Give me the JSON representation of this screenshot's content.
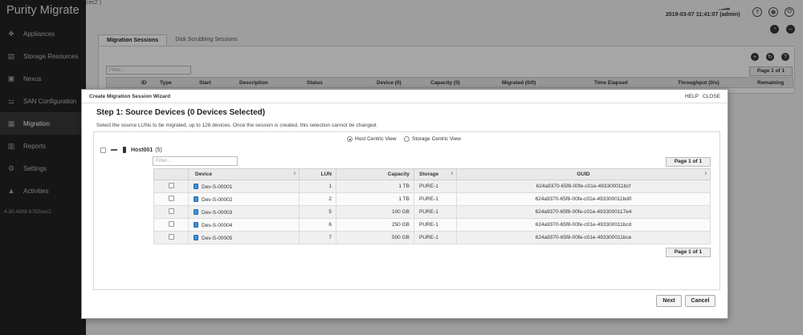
{
  "app": {
    "logo": "Purity Migrate",
    "version": "4.30.4308.6782cec2",
    "breadcrumb": "cec2 )"
  },
  "sidebar": {
    "items": [
      {
        "label": "Appliances",
        "icon": "layers-icon",
        "active": false
      },
      {
        "label": "Storage Resources",
        "icon": "storage-icon",
        "active": false
      },
      {
        "label": "Nexus",
        "icon": "nexus-icon",
        "active": false
      },
      {
        "label": "SAN Configuration",
        "icon": "san-icon",
        "active": false
      },
      {
        "label": "Migration",
        "icon": "migration-icon",
        "active": true
      },
      {
        "label": "Reports",
        "icon": "reports-icon",
        "active": false
      },
      {
        "label": "Settings",
        "icon": "gear-icon",
        "active": false
      },
      {
        "label": "Activities",
        "icon": "bell-icon",
        "active": false
      }
    ]
  },
  "header": {
    "datetime": "2019-03-07 11:41:07 (admin)",
    "icons": [
      "help-icon",
      "settings-icon",
      "power-icon"
    ]
  },
  "background": {
    "tabs": [
      "Migration Sessions",
      "Disk Scrubbing Sessions"
    ],
    "filter_placeholder": "Filter...",
    "pager": "Page 1 of 1",
    "columns": [
      "ID",
      "Type",
      "Start",
      "Description",
      "Status",
      "Device (0)",
      "Capacity (0)",
      "Migrated (0/0)",
      "Time Elapsed",
      "Throughput (0/s)",
      "Remaining"
    ]
  },
  "modal": {
    "title": "Create Migration Session Wizard",
    "help": "HELP",
    "close": "CLOSE",
    "step_title": "Step 1: Source Devices (0 Devices Selected)",
    "step_desc": "Select the source LUNs to be migrated, up to 128 devices. Once the session is created, this selection cannot be changed.",
    "view_options": {
      "host": "Host Centric View",
      "storage": "Storage Centric View",
      "selected": "host"
    },
    "host": {
      "name": "Host001",
      "count": "(5)"
    },
    "filter_placeholder": "Filter...",
    "pager_top": "Page 1 of 1",
    "pager_bottom": "Page 1 of 1",
    "columns": {
      "device": "Device",
      "lun": "LUN",
      "capacity": "Capacity",
      "storage": "Storage",
      "guid": "GUID"
    },
    "rows": [
      {
        "device": "Dev-S-00001",
        "lun": "1",
        "capacity": "1 TB",
        "storage": "PURE-1",
        "guid": "624a9370-65f8-00fe-c01e-493300011bcf"
      },
      {
        "device": "Dev-S-00002",
        "lun": "2",
        "capacity": "1 TB",
        "storage": "PURE-1",
        "guid": "624a9370-65f8-00fe-c01e-493300011bd0"
      },
      {
        "device": "Dev-S-00003",
        "lun": "5",
        "capacity": "100 GB",
        "storage": "PURE-1",
        "guid": "624a9370-65f8-00fe-c01e-4933000117e4"
      },
      {
        "device": "Dev-S-00004",
        "lun": "6",
        "capacity": "250 GB",
        "storage": "PURE-1",
        "guid": "624a9370-65f8-00fe-c01e-493300011bcd"
      },
      {
        "device": "Dev-S-00005",
        "lun": "7",
        "capacity": "500 GB",
        "storage": "PURE-1",
        "guid": "624a9370-65f8-00fe-c01e-493300011bce"
      }
    ],
    "next_label": "Next",
    "cancel_label": "Cancel"
  }
}
